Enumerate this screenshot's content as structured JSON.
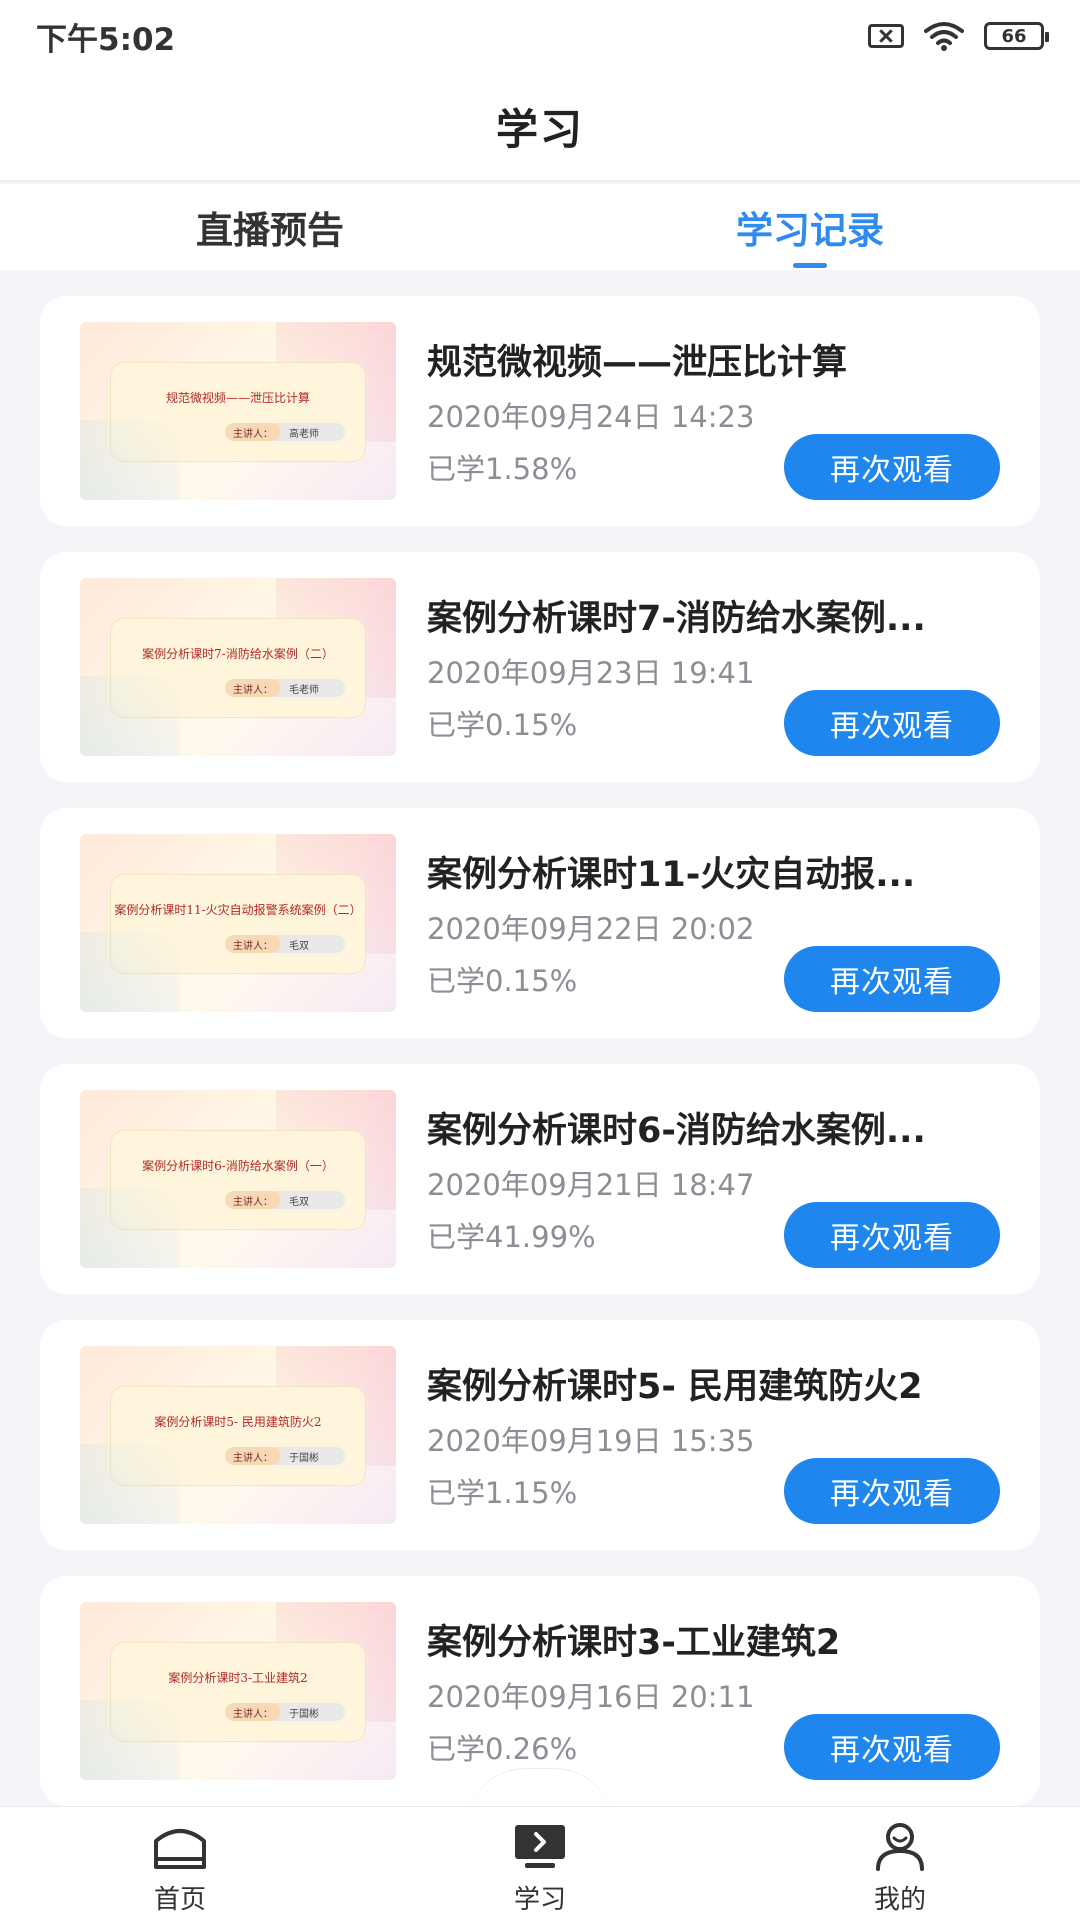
{
  "status_bar": {
    "time": "下午5:02",
    "battery": "66"
  },
  "header": {
    "title": "学习"
  },
  "tabs": [
    {
      "label": "直播预告",
      "active": false
    },
    {
      "label": "学习记录",
      "active": true
    }
  ],
  "records": [
    {
      "title": "规范微视频——泄压比计算",
      "date": "2020年09月24日 14:23",
      "progress": "已学1.58%",
      "button": "再次观看",
      "thumb_title": "规范微视频——泄压比计算",
      "thumb_label": "主讲人：",
      "thumb_speaker": "高老师"
    },
    {
      "title": "案例分析课时7-消防给水案例...",
      "date": "2020年09月23日 19:41",
      "progress": "已学0.15%",
      "button": "再次观看",
      "thumb_title": "案例分析课时7-消防给水案例（二）",
      "thumb_label": "主讲人：",
      "thumb_speaker": "毛老师"
    },
    {
      "title": "案例分析课时11-火灾自动报...",
      "date": "2020年09月22日 20:02",
      "progress": "已学0.15%",
      "button": "再次观看",
      "thumb_title": "案例分析课时11-火灾自动报警系统案例（二）",
      "thumb_label": "主讲人：",
      "thumb_speaker": "毛双"
    },
    {
      "title": "案例分析课时6-消防给水案例...",
      "date": "2020年09月21日 18:47",
      "progress": "已学41.99%",
      "button": "再次观看",
      "thumb_title": "案例分析课时6-消防给水案例（一）",
      "thumb_label": "主讲人：",
      "thumb_speaker": "毛双"
    },
    {
      "title": "案例分析课时5- 民用建筑防火2",
      "date": "2020年09月19日 15:35",
      "progress": "已学1.15%",
      "button": "再次观看",
      "thumb_title": "案例分析课时5- 民用建筑防火2",
      "thumb_label": "主讲人：",
      "thumb_speaker": "于国彬"
    },
    {
      "title": "案例分析课时3-工业建筑2",
      "date": "2020年09月16日 20:11",
      "progress": "已学0.26%",
      "button": "再次观看",
      "thumb_title": "案例分析课时3-工业建筑2",
      "thumb_label": "主讲人：",
      "thumb_speaker": "于国彬"
    }
  ],
  "bottom_nav": [
    {
      "label": "首页",
      "icon": "home-icon"
    },
    {
      "label": "学习",
      "icon": "study-icon",
      "active": true
    },
    {
      "label": "我的",
      "icon": "profile-icon"
    }
  ],
  "colors": {
    "accent": "#2f8bf0",
    "button": "#1f86ee",
    "background": "#f3f5f8"
  }
}
